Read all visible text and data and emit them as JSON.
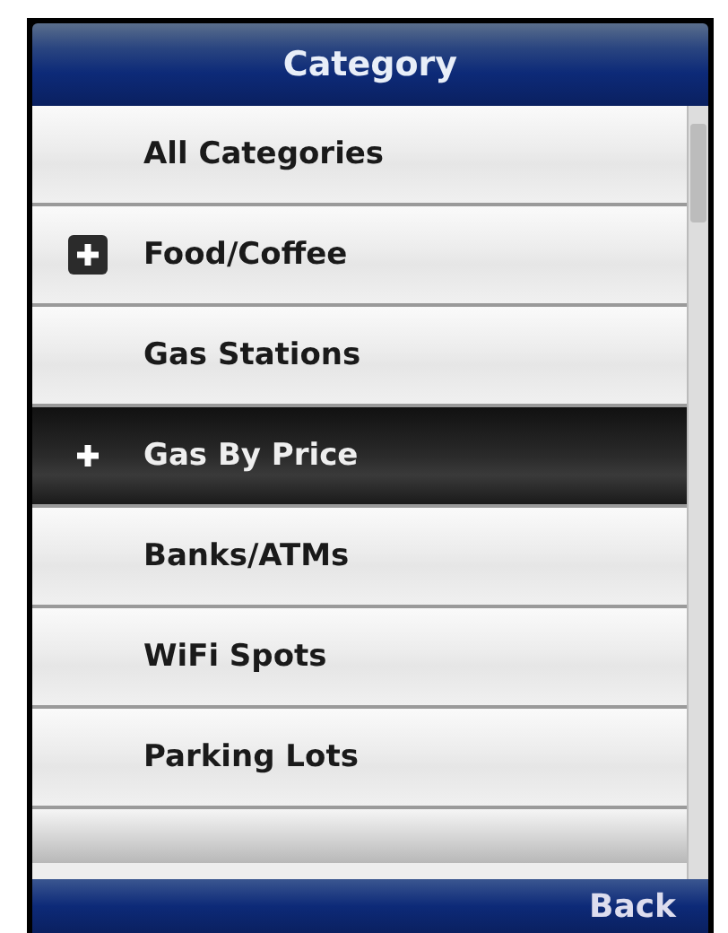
{
  "title": "Category",
  "items": [
    {
      "label": "All Categories",
      "expandable": false,
      "selected": false
    },
    {
      "label": "Food/Coffee",
      "expandable": true,
      "selected": false
    },
    {
      "label": "Gas Stations",
      "expandable": false,
      "selected": false
    },
    {
      "label": "Gas By Price",
      "expandable": true,
      "selected": true
    },
    {
      "label": "Banks/ATMs",
      "expandable": false,
      "selected": false
    },
    {
      "label": "WiFi Spots",
      "expandable": false,
      "selected": false
    },
    {
      "label": "Parking Lots",
      "expandable": false,
      "selected": false
    }
  ],
  "softkey": "Back"
}
